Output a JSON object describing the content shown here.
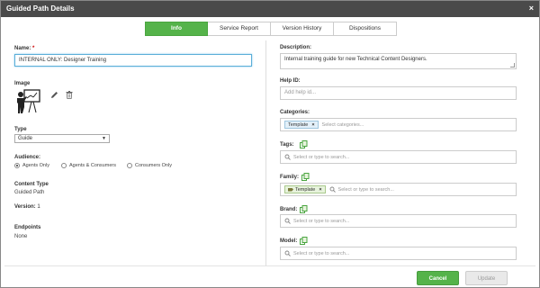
{
  "window": {
    "title": "Guided Path Details",
    "close_glyph": "×"
  },
  "tabs": [
    {
      "label": "Info",
      "active": true
    },
    {
      "label": "Service Report",
      "active": false
    },
    {
      "label": "Version History",
      "active": false
    },
    {
      "label": "Dispositions",
      "active": false
    }
  ],
  "left": {
    "name_label": "Name:",
    "name_required": "*",
    "name_value": "INTERNAL ONLY: Designer Training",
    "image_label": "Image",
    "type_label": "Type",
    "type_value": "Guide",
    "audience_label": "Audience:",
    "audience_options": [
      "Agents Only",
      "Agents & Consumers",
      "Consumers Only"
    ],
    "audience_selected": "Agents Only",
    "content_type_label": "Content Type",
    "content_type_value": "Guided Path",
    "version_label": "Version:",
    "version_value": "1",
    "endpoints_label": "Endpoints",
    "endpoints_value": "None"
  },
  "right": {
    "description_label": "Description:",
    "description_value": "Internal training guide for new Technical Content Designers.",
    "help_id_label": "Help ID:",
    "help_id_placeholder": "Add help id...",
    "categories_label": "Categories:",
    "categories_tag": "Template",
    "categories_placeholder": "Select categories...",
    "tags_label": "Tags:",
    "tags_placeholder": "Select or type to search...",
    "family_label": "Family:",
    "family_tag": "Template",
    "family_placeholder": "Select or type to search...",
    "brand_label": "Brand:",
    "brand_placeholder": "Select or type to search...",
    "model_label": "Model:",
    "model_placeholder": "Select or type to search..."
  },
  "footer": {
    "cancel_label": "Cancel",
    "update_label": "Update"
  },
  "colors": {
    "accent_green": "#55b34a",
    "titlebar": "#4a4a4a",
    "tag_blue": "#e3f0f9"
  }
}
